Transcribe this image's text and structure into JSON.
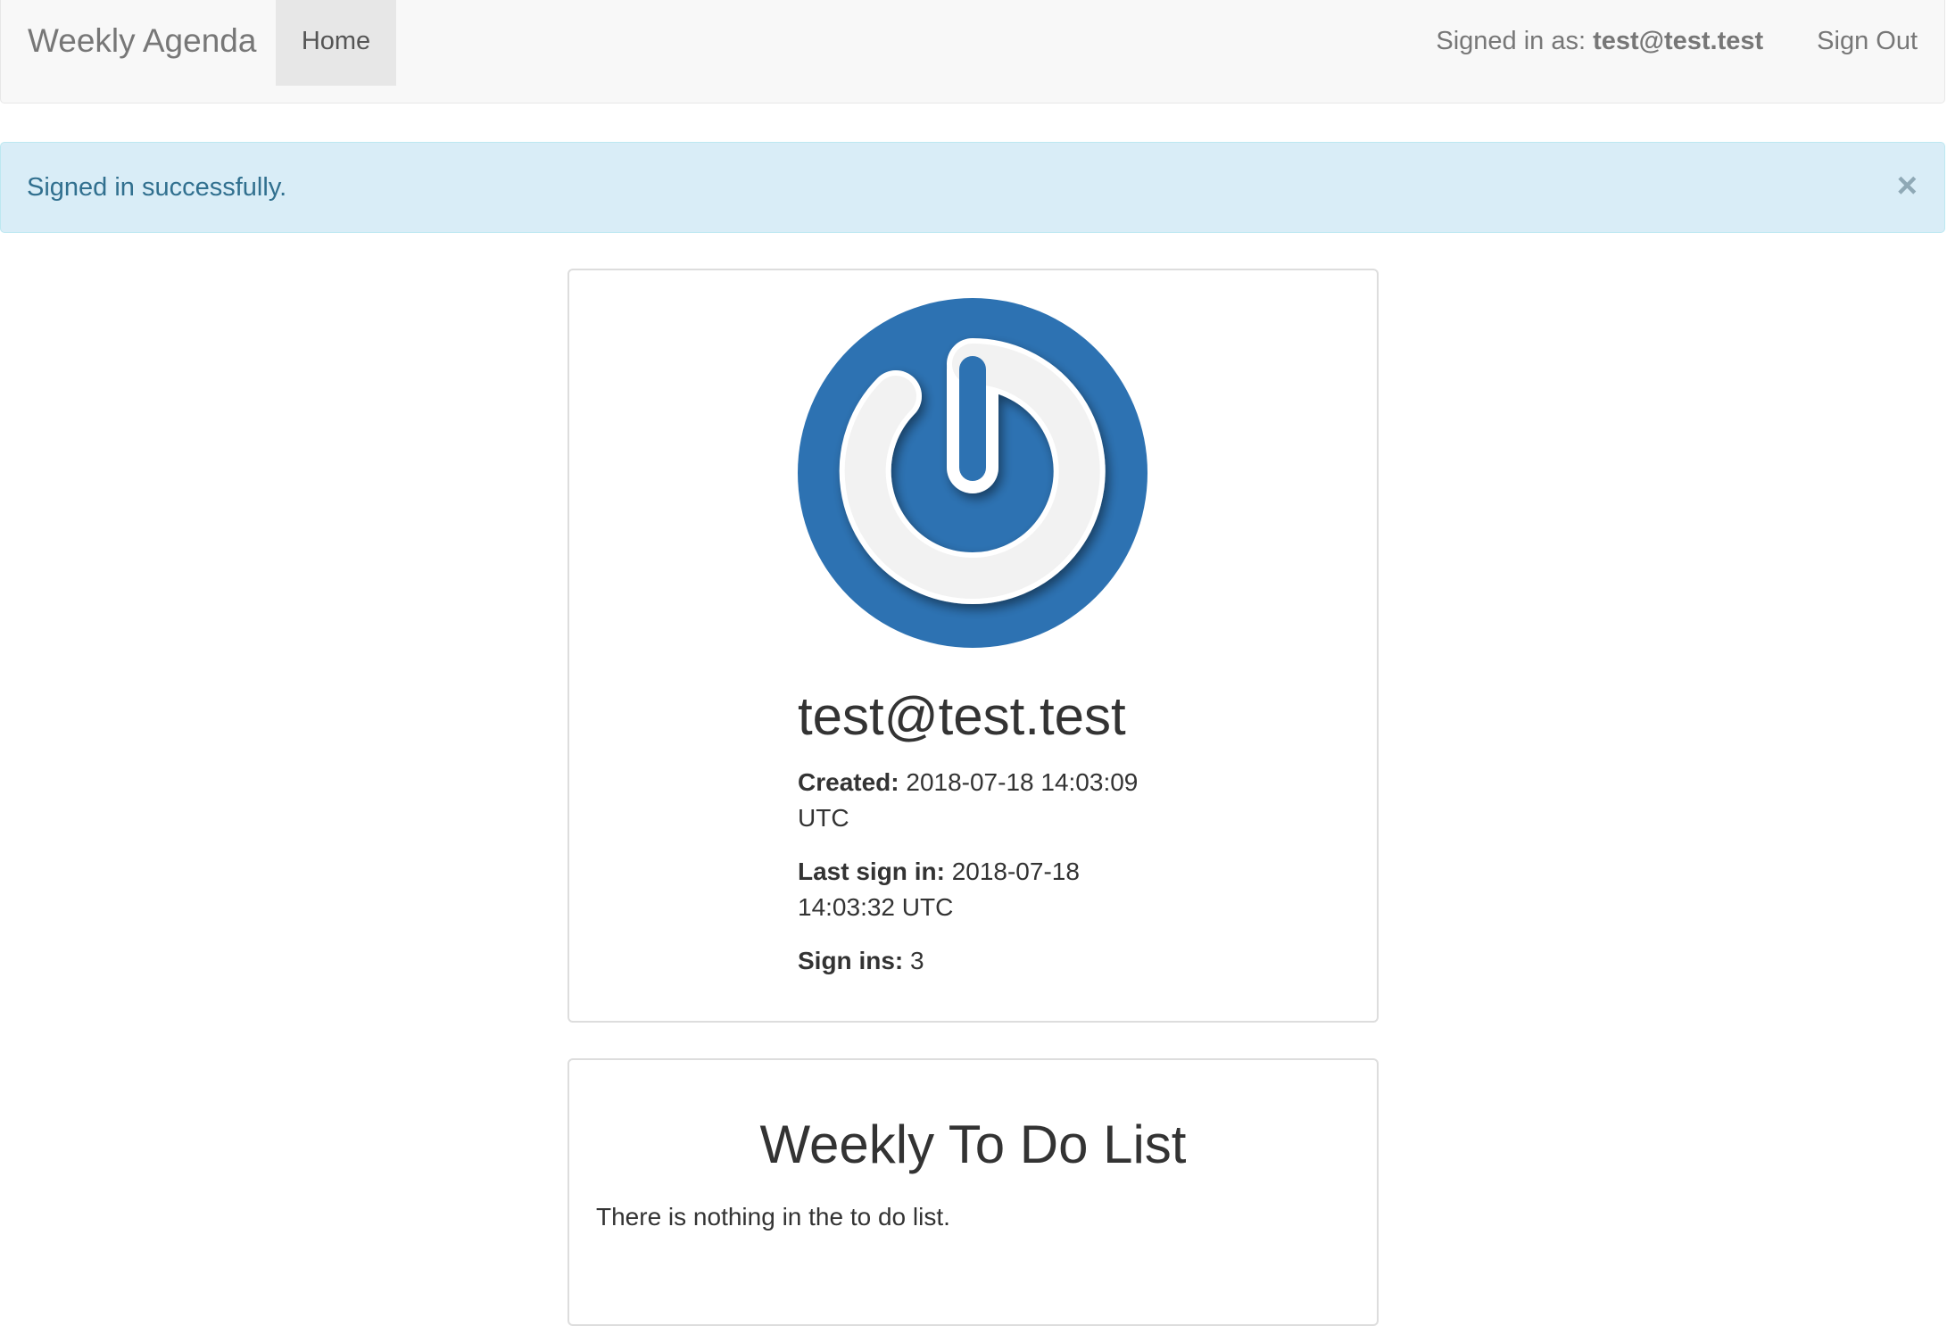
{
  "navbar": {
    "brand": "Weekly Agenda",
    "home_label": "Home",
    "signed_in_prefix": "Signed in as:",
    "signed_in_user": "test@test.test",
    "sign_out_label": "Sign Out"
  },
  "alert": {
    "message": "Signed in successfully.",
    "close_label": "×"
  },
  "profile": {
    "email": "test@test.test",
    "created_label": "Created:",
    "created_value": "2018-07-18 14:03:09 UTC",
    "last_sign_in_label": "Last sign in:",
    "last_sign_in_value": "2018-07-18 14:03:32 UTC",
    "sign_ins_label": "Sign ins:",
    "sign_ins_value": "3",
    "avatar_icon": "power-icon",
    "avatar_color": "#2d72b2"
  },
  "todo": {
    "title": "Weekly To Do List",
    "empty_text": "There is nothing in the to do list."
  }
}
